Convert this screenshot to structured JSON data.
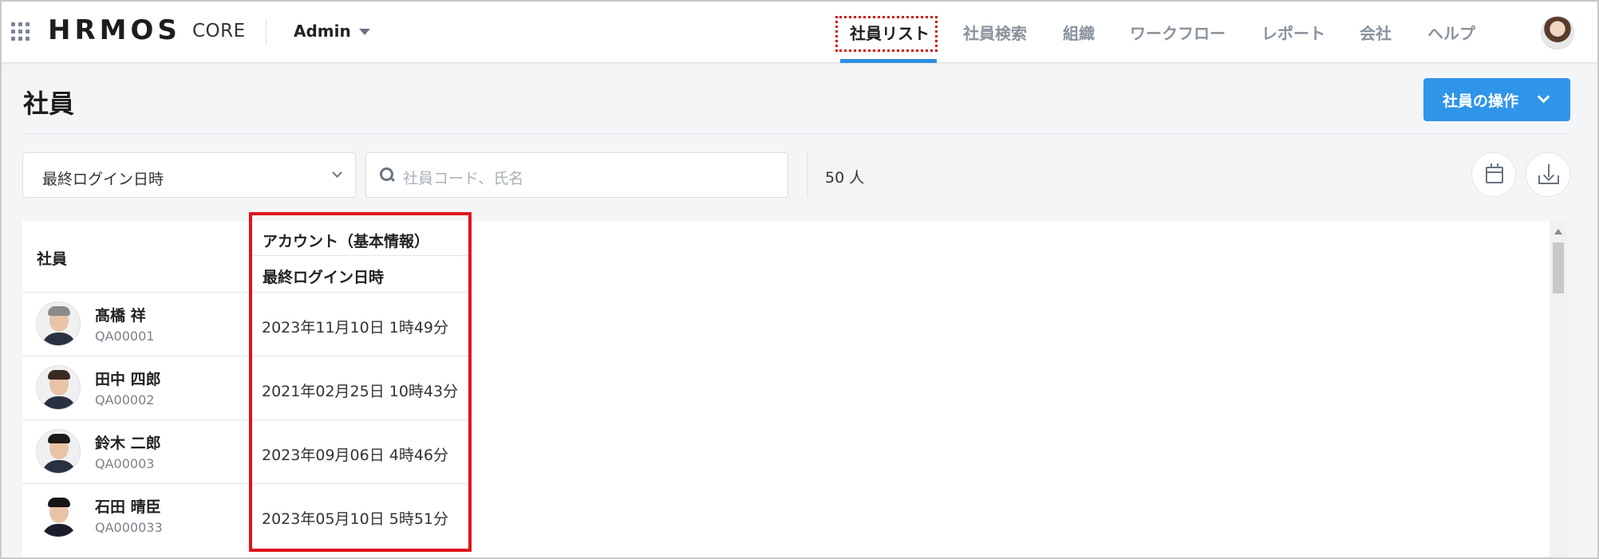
{
  "header": {
    "logo": "HRMOS",
    "logo_sub": "CORE",
    "account": "Admin",
    "nav": [
      {
        "label": "社員リスト",
        "active": true
      },
      {
        "label": "社員検索",
        "active": false
      },
      {
        "label": "組織",
        "active": false
      },
      {
        "label": "ワークフロー",
        "active": false
      },
      {
        "label": "レポート",
        "active": false
      },
      {
        "label": "会社",
        "active": false
      },
      {
        "label": "ヘルプ",
        "active": false
      }
    ]
  },
  "page": {
    "title": "社員",
    "action_button": "社員の操作"
  },
  "filters": {
    "select_value": "最終ログイン日時",
    "search_placeholder": "社員コード、氏名",
    "count": "50 人"
  },
  "table": {
    "col_employee": "社員",
    "col_group": "アカウント（基本情報）",
    "col_sub": "最終ログイン日時",
    "rows": [
      {
        "name": "髙橋 祥",
        "code": "QA00001",
        "last_login": "2023年11月10日 1時49分"
      },
      {
        "name": "田中 四郎",
        "code": "QA00002",
        "last_login": "2021年02月25日 10時43分"
      },
      {
        "name": "鈴木 二郎",
        "code": "QA00003",
        "last_login": "2023年09月06日 4時46分"
      },
      {
        "name": "石田 晴臣",
        "code": "QA000033",
        "last_login": "2023年05月10日 5時51分"
      }
    ]
  },
  "colors": {
    "accent": "#2f95e8",
    "nav_underline": "#2f8fe0",
    "highlight_red": "#e0141e"
  }
}
